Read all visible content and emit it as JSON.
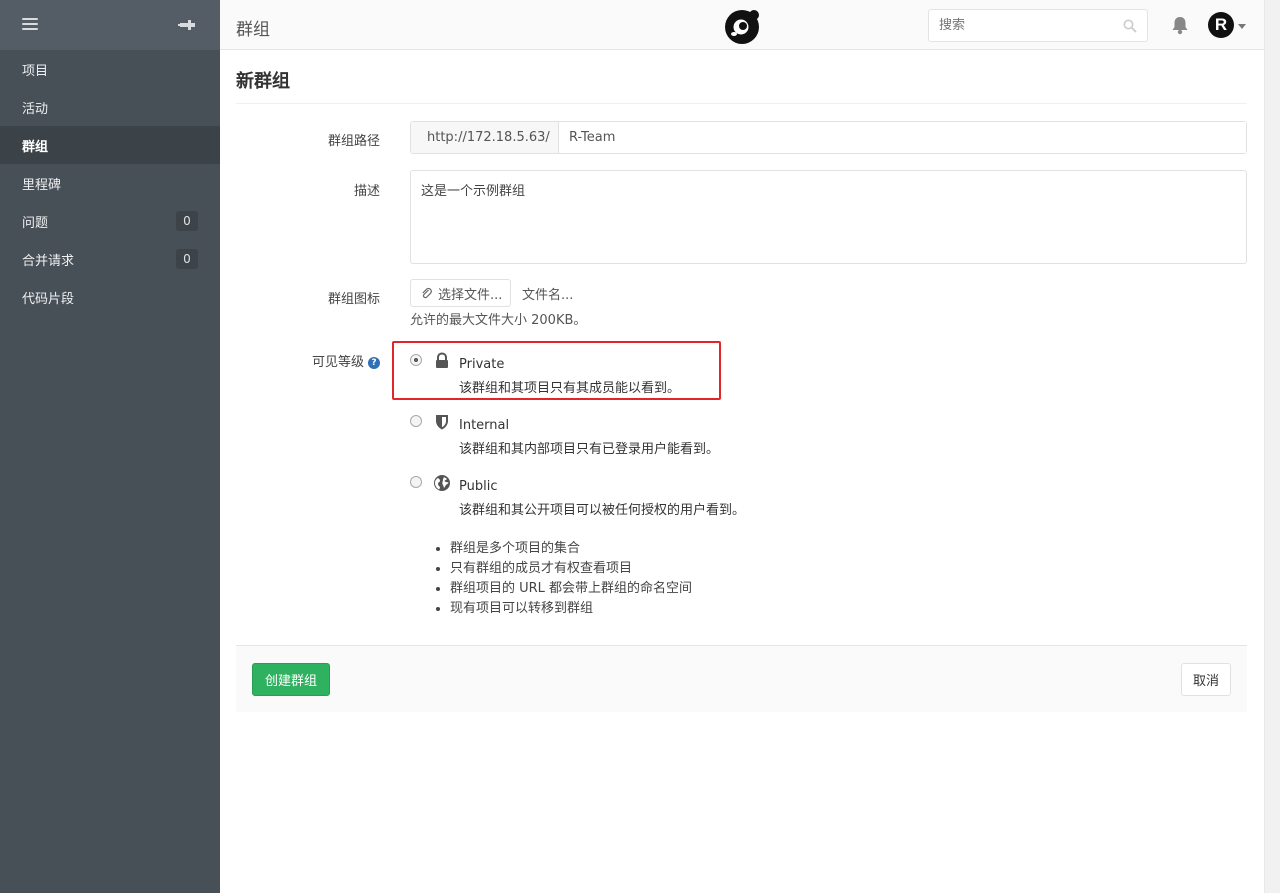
{
  "sidebar": {
    "items": [
      {
        "label": "项目",
        "count": null,
        "active": false
      },
      {
        "label": "活动",
        "count": null,
        "active": false
      },
      {
        "label": "群组",
        "count": null,
        "active": true
      },
      {
        "label": "里程碑",
        "count": null,
        "active": false
      },
      {
        "label": "问题",
        "count": "0",
        "active": false
      },
      {
        "label": "合并请求",
        "count": "0",
        "active": false
      },
      {
        "label": "代码片段",
        "count": null,
        "active": false
      }
    ]
  },
  "header": {
    "title": "群组",
    "search_placeholder": "搜索",
    "avatar_letter": "R"
  },
  "form": {
    "page_title": "新群组",
    "path_label": "群组路径",
    "path_prefix": "http://172.18.5.63/",
    "path_value": "R-Team",
    "desc_label": "描述",
    "desc_value": "这是一个示例群组",
    "avatar_label": "群组图标",
    "file_button": "选择文件...",
    "file_name": "文件名...",
    "file_hint": "允许的最大文件大小 200KB。",
    "visibility_label": "可见等级",
    "visibility_help": "?",
    "visibility_options": [
      {
        "name": "Private",
        "desc": "该群组和其项目只有其成员能以看到。",
        "icon": "lock-icon",
        "checked": true
      },
      {
        "name": "Internal",
        "desc": "该群组和其内部项目只有已登录用户能看到。",
        "icon": "shield-icon",
        "checked": false
      },
      {
        "name": "Public",
        "desc": "该群组和其公开项目可以被任何授权的用户看到。",
        "icon": "globe-icon",
        "checked": false
      }
    ],
    "info": [
      "群组是多个项目的集合",
      "只有群组的成员才有权查看项目",
      "群组项目的 URL 都会带上群组的命名空间",
      "现有项目可以转移到群组"
    ],
    "create_button": "创建群组",
    "cancel_button": "取消"
  },
  "colors": {
    "sidebar_bg": "#474f57",
    "primary_green": "#2fb25f",
    "highlight_red": "#e0262b"
  }
}
